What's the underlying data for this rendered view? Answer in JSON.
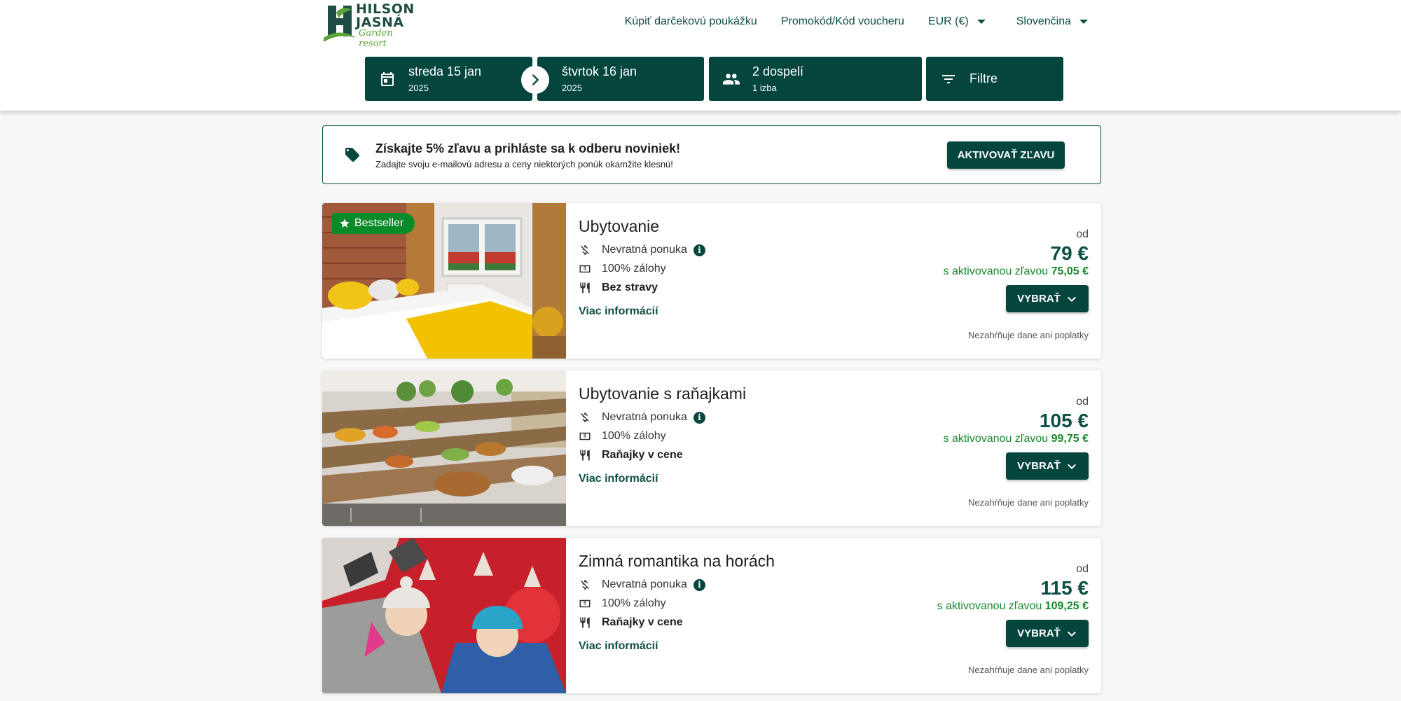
{
  "header": {
    "logo": {
      "line1": "HILSON",
      "line2": "JASNÁ",
      "script": "Garden resort"
    },
    "nav": {
      "gift": "Kúpiť darčekovú poukážku",
      "promo": "Promokód/Kód voucheru",
      "currency": "EUR (€)",
      "language": "Slovenčina"
    }
  },
  "booking": {
    "checkin": {
      "day": "streda 15 jan",
      "year": "2025"
    },
    "checkout": {
      "day": "štvrtok 16 jan",
      "year": "2025"
    },
    "guests": {
      "main": "2 dospelí",
      "sub": "1 izba"
    },
    "filters": "Filtre"
  },
  "promo": {
    "title": "Získajte 5% zľavu a prihláste sa k odberu noviniek!",
    "subtitle": "Zadajte svoju e-mailovú adresu a ceny niektorých ponúk okamžite klesnú!",
    "button": "AKTIVOVAŤ ZĽAVU"
  },
  "cards": [
    {
      "badge": "Bestseller",
      "title": "Ubytovanie",
      "refund": "Nevratná ponuka",
      "deposit": "100% zálohy",
      "board": "Bez stravy",
      "more": "Viac informácií",
      "from": "od",
      "price": "79 €",
      "discount_label": "s aktivovanou zľavou",
      "discount_price": "75,05 €",
      "button": "VYBRAŤ",
      "tax": "Nezahŕňuje dane ani poplatky"
    },
    {
      "title": "Ubytovanie s raňajkami",
      "refund": "Nevratná ponuka",
      "deposit": "100% zálohy",
      "board": "Raňajky v cene",
      "more": "Viac informácií",
      "from": "od",
      "price": "105 €",
      "discount_label": "s aktivovanou zľavou",
      "discount_price": "99,75 €",
      "button": "VYBRAŤ",
      "tax": "Nezahŕňuje dane ani poplatky"
    },
    {
      "title": "Zimná romantika na horách",
      "refund": "Nevratná ponuka",
      "deposit": "100% zálohy",
      "board": "Raňajky v cene",
      "more": "Viac informácií",
      "from": "od",
      "price": "115 €",
      "discount_label": "s aktivovanou zľavou",
      "discount_price": "109,25 €",
      "button": "VYBRAŤ",
      "tax": "Nezahŕňuje dane ani poplatky"
    }
  ],
  "colors": {
    "primary": "#04463e",
    "accent_green": "#138a2a",
    "badge": "#0b8a2a"
  }
}
